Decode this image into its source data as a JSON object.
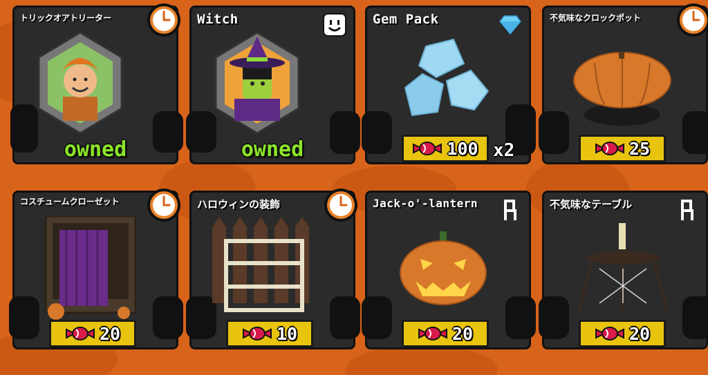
{
  "theme": {
    "background": "#d8631a",
    "card": "#2b2b2b",
    "price_bg": "#e8c40f",
    "owned_color": "#8be628",
    "currency_color": "#d81b4a"
  },
  "items": [
    {
      "name": "トリックオアトリーター",
      "badge": "clock-icon",
      "status": "owned"
    },
    {
      "name": "Witch",
      "badge": "face-icon",
      "status": "owned"
    },
    {
      "name": "Gem Pack",
      "badge": "diamond-icon",
      "price": "100",
      "quantity": "x2",
      "currency": "candy-icon"
    },
    {
      "name": "不気味なクロックポット",
      "badge": "clock-icon",
      "price": "25",
      "currency": "candy-icon"
    },
    {
      "name": "コスチュームクローゼット",
      "badge": "clock-icon",
      "price": "20",
      "currency": "candy-icon"
    },
    {
      "name": "ハロウィンの装飾",
      "badge": "clock-icon",
      "price": "10",
      "currency": "candy-icon"
    },
    {
      "name": "Jack-o'-lantern",
      "badge": "chair-icon",
      "price": "20",
      "currency": "candy-icon"
    },
    {
      "name": "不気味なテーブル",
      "badge": "chair-icon",
      "price": "20",
      "currency": "candy-icon"
    }
  ]
}
